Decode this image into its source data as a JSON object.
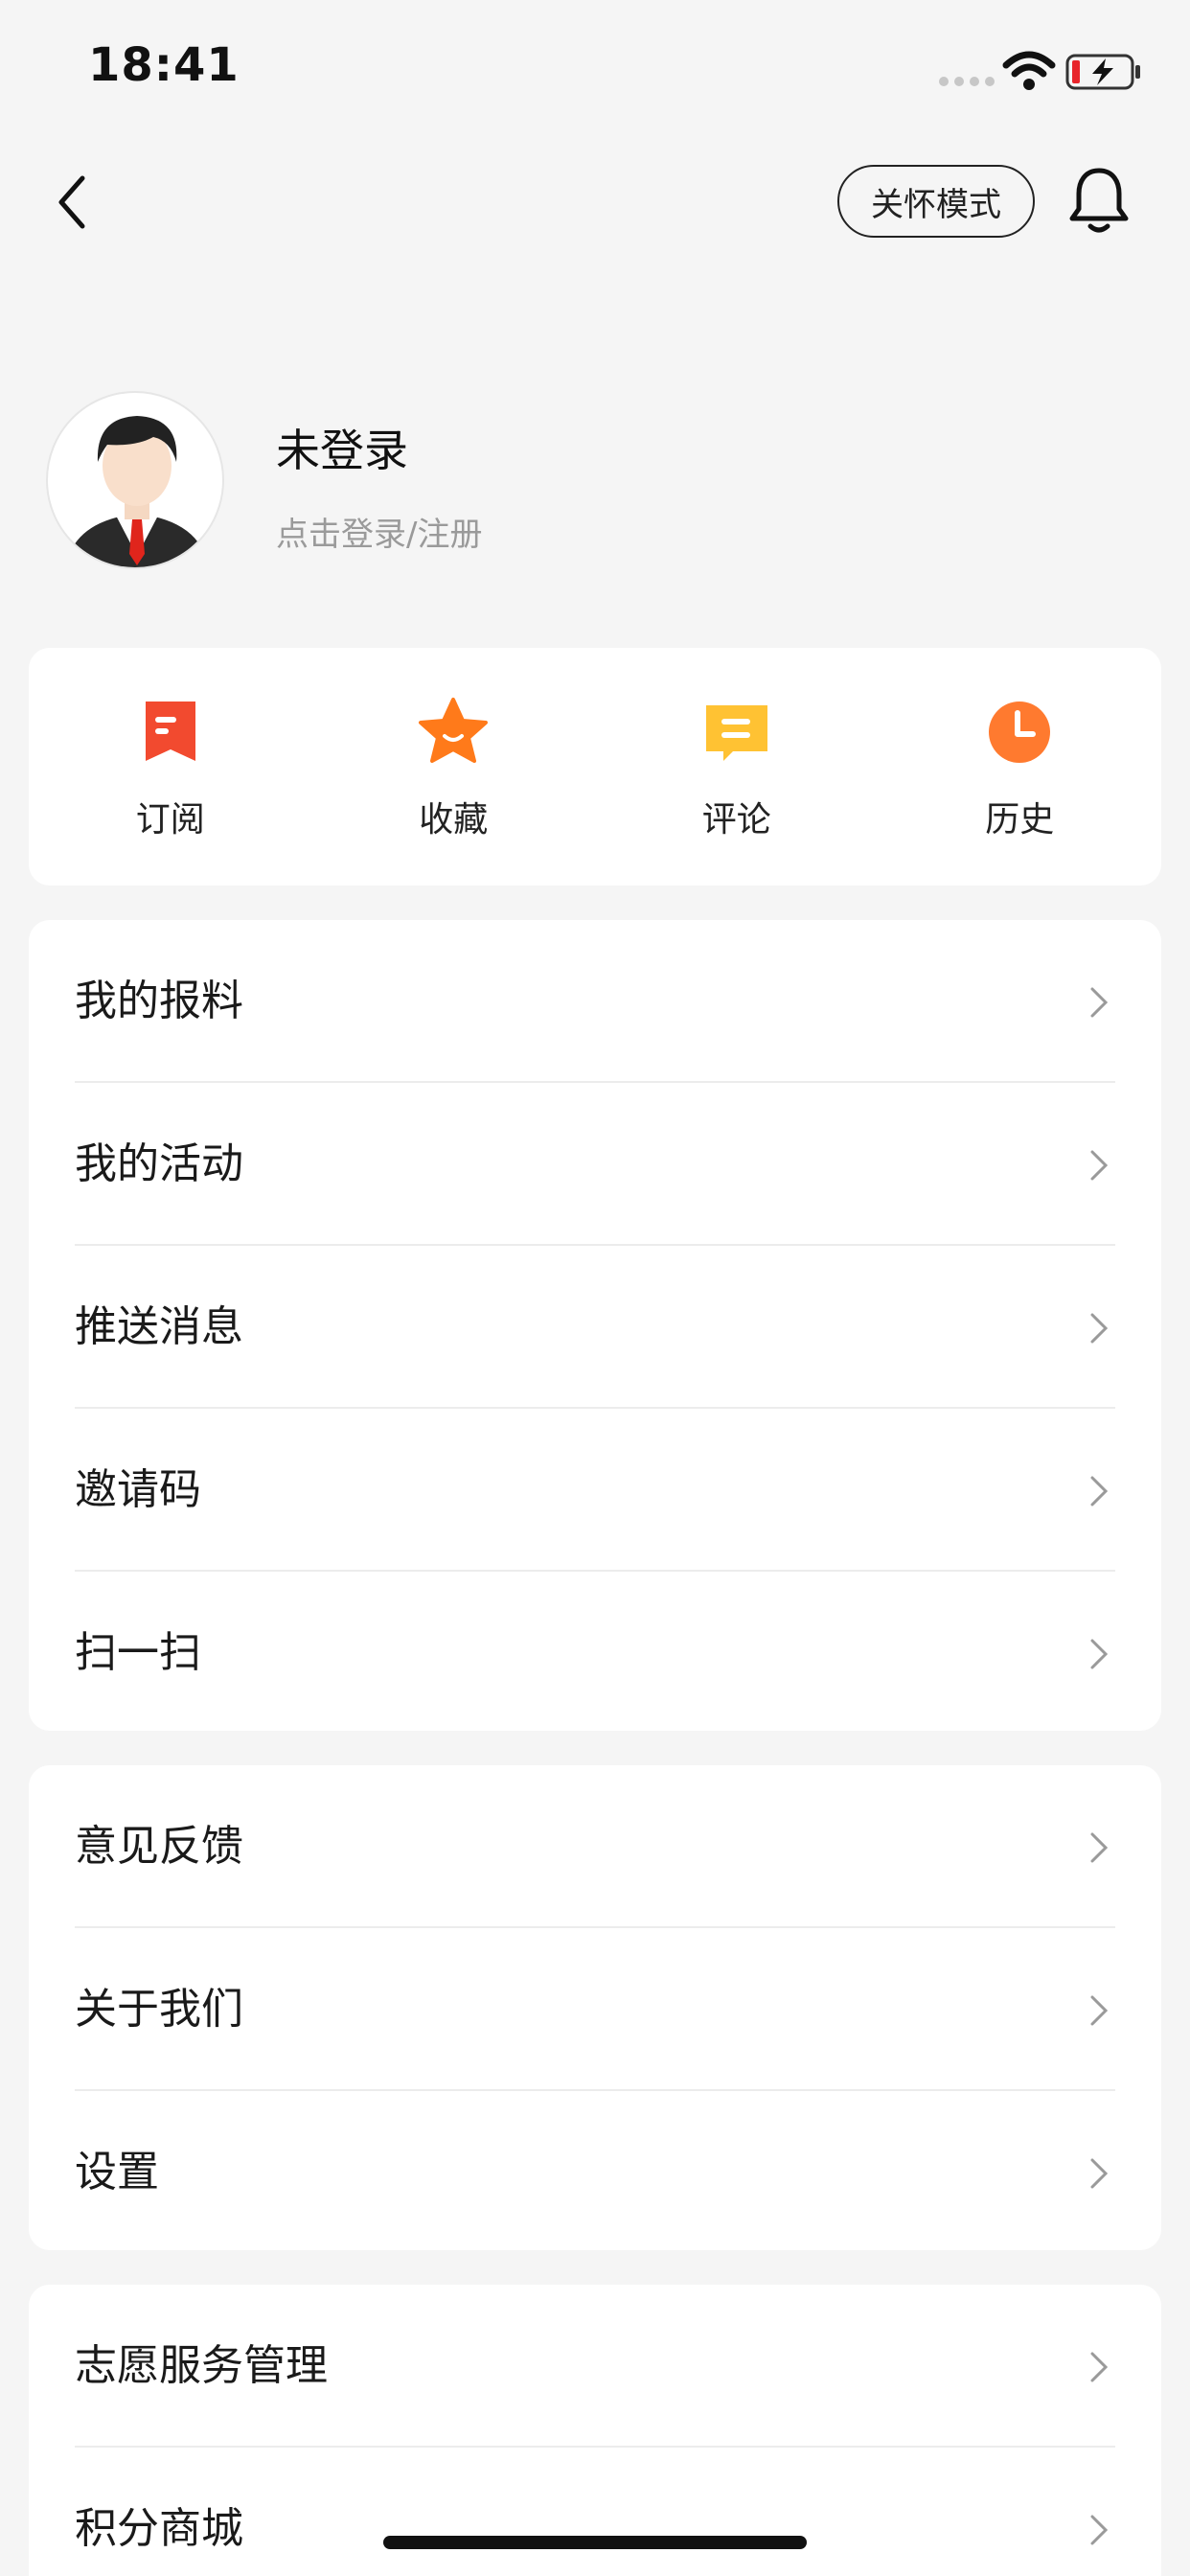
{
  "status_bar": {
    "time": "18:41"
  },
  "header": {
    "care_mode_label": "关怀模式"
  },
  "profile": {
    "name": "未登录",
    "subtitle": "点击登录/注册"
  },
  "quick_actions": [
    {
      "label": "订阅",
      "icon": "bookmark-icon",
      "color": "#f24a2f"
    },
    {
      "label": "收藏",
      "icon": "star-icon",
      "color": "#ff7a1a"
    },
    {
      "label": "评论",
      "icon": "comment-icon",
      "color": "#ffc233"
    },
    {
      "label": "历史",
      "icon": "clock-icon",
      "color": "#ff7a2f"
    }
  ],
  "menu_group_1": [
    "我的报料",
    "我的活动",
    "推送消息",
    "邀请码",
    "扫一扫"
  ],
  "menu_group_2": [
    "意见反馈",
    "关于我们",
    "设置"
  ],
  "menu_group_3": [
    "志愿服务管理",
    "积分商城"
  ]
}
